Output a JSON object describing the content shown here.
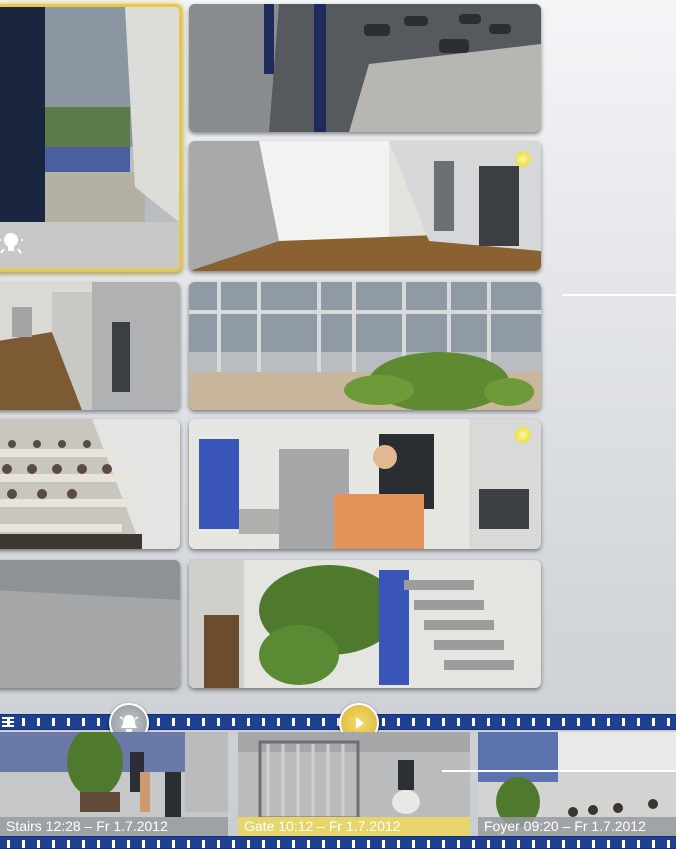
{
  "camera_grid": {
    "tiles": [
      {
        "name": "terrace-view",
        "selected": true
      },
      {
        "name": "parking-lot-view"
      },
      {
        "name": "hallway-view-1"
      },
      {
        "name": "corridor-view-left"
      },
      {
        "name": "atrium-glass-view"
      },
      {
        "name": "lecture-hall-view"
      },
      {
        "name": "lobby-person-view"
      },
      {
        "name": "empty-floor-view"
      },
      {
        "name": "stairwell-tree-view"
      }
    ]
  },
  "filmstrip": {
    "alarm_button_icon": "alarm-bell-icon",
    "play_button_icon": "play-icon",
    "menu_icon": "menu-icon",
    "clips": [
      {
        "caption": "Stairs 12:28 – Fr 1.7.2012",
        "active": false
      },
      {
        "caption": "Gate 10:12 – Fr 1.7.2012",
        "active": true
      },
      {
        "caption": "Foyer 09:20 – Fr 1.7.2012",
        "active": false
      }
    ]
  },
  "colors": {
    "rail": "#1f3f8f",
    "highlight": "#e4c84a",
    "play_button": "#e7c84c"
  }
}
